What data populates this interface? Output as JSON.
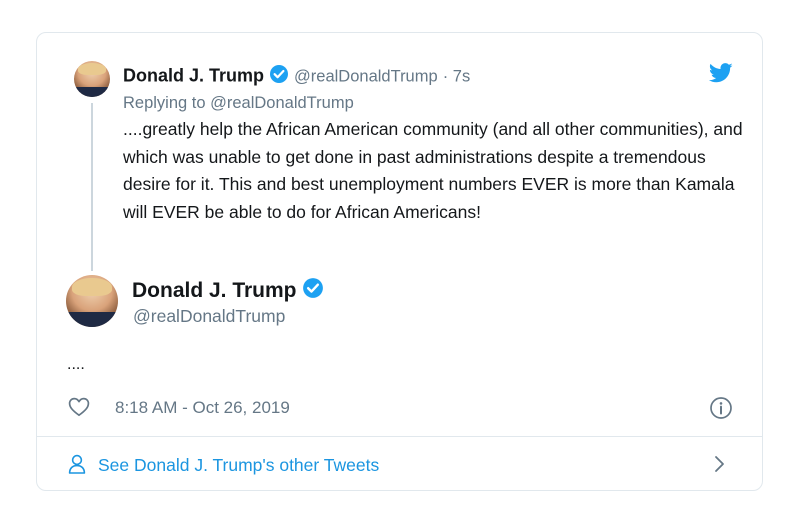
{
  "quoted": {
    "display_name": "Donald J. Trump",
    "handle": "@realDonaldTrump",
    "age": "· 7s",
    "reply_to": "Replying to @realDonaldTrump",
    "text": "....greatly help the African American community (and all other communities), and which was unable to get done in past administrations despite a tremendous desire for it. This and best unemployment numbers EVER is more than Kamala will EVER be able to do for African Americans!"
  },
  "main": {
    "display_name": "Donald J. Trump",
    "handle": "@realDonaldTrump",
    "text": "....",
    "timestamp": "8:18 AM - Oct 26, 2019"
  },
  "footer": {
    "other_tweets_label": "See Donald J. Trump's other Tweets"
  },
  "colors": {
    "accent": "#1b95e0",
    "verified": "#1da1f2",
    "muted": "#657786",
    "border": "#e1e8ed"
  },
  "icons": [
    "twitter-bird-icon",
    "verified-badge-icon",
    "heart-icon",
    "info-icon",
    "person-icon",
    "chevron-right-icon"
  ]
}
